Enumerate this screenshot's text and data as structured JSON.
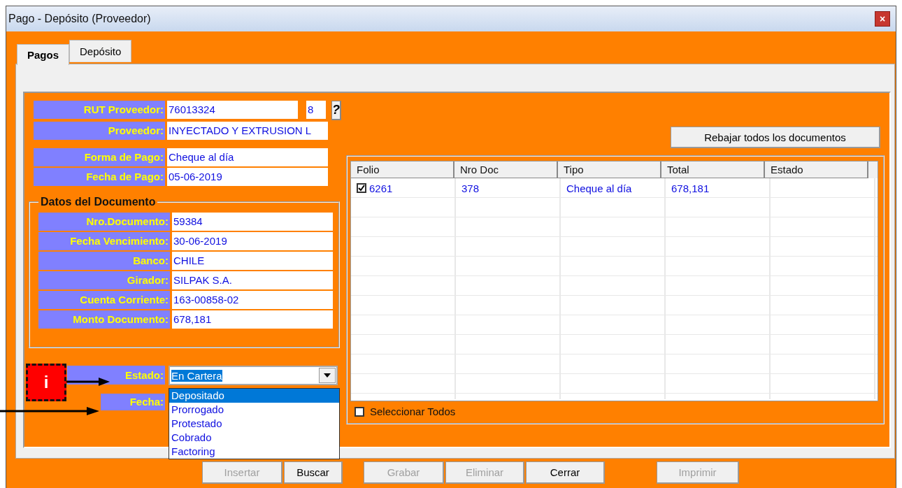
{
  "window": {
    "title": "Pago - Depósito (Proveedor)",
    "close": "×"
  },
  "tabs": [
    {
      "label": "Pagos",
      "selected": true
    },
    {
      "label": "Depósito",
      "selected": false
    }
  ],
  "rut": {
    "label": "RUT Proveedor:",
    "value": "76013324",
    "check_digit": "8",
    "help": "?"
  },
  "supplier": {
    "label": "Proveedor:",
    "value": "INYECTADO Y EXTRUSION L"
  },
  "payment": [
    {
      "label": "Forma de Pago:",
      "value": "Cheque al día"
    },
    {
      "label": "Fecha de Pago:",
      "value": "05-06-2019"
    }
  ],
  "document": {
    "title": "Datos del Documento",
    "fields": [
      {
        "label": "Nro.Documento:",
        "value": "59384"
      },
      {
        "label": "Fecha Vencimiento:",
        "value": "30-06-2019"
      },
      {
        "label": "Banco:",
        "value": "CHILE"
      },
      {
        "label": "Girador:",
        "value": "SILPAK S.A."
      },
      {
        "label": "Cuenta Corriente:",
        "value": "163-00858-02"
      },
      {
        "label": "Monto Documento:",
        "value": "678,181"
      }
    ]
  },
  "status": {
    "label": "Estado:",
    "value": "En Cartera",
    "expanded": true,
    "options": [
      {
        "label": "Depositado",
        "selected": true
      },
      {
        "label": "Prorrogado",
        "selected": false
      },
      {
        "label": "Protestado",
        "selected": false
      },
      {
        "label": "Cobrado",
        "selected": false
      },
      {
        "label": "Factoring",
        "selected": false
      }
    ]
  },
  "date": {
    "label": "Fecha:"
  },
  "annotation": {
    "marker": "i"
  },
  "rebajar_button": "Rebajar todos los documentos",
  "table": {
    "columns": [
      "Folio",
      "Nro Doc",
      "Tipo",
      "Total",
      "Estado"
    ],
    "rows": [
      {
        "checked": true,
        "cells": [
          "6261",
          "378",
          "Cheque al día",
          "678,181",
          ""
        ]
      }
    ]
  },
  "select_all": {
    "label": "Seleccionar Todos",
    "checked": false
  },
  "buttons": [
    {
      "label": "Insertar",
      "disabled": true
    },
    {
      "label": "Buscar",
      "disabled": false
    },
    {
      "label": "Grabar",
      "disabled": true
    },
    {
      "label": "Eliminar",
      "disabled": true
    },
    {
      "label": "Cerrar",
      "disabled": false
    },
    {
      "label": "Imprimir",
      "disabled": true
    }
  ]
}
